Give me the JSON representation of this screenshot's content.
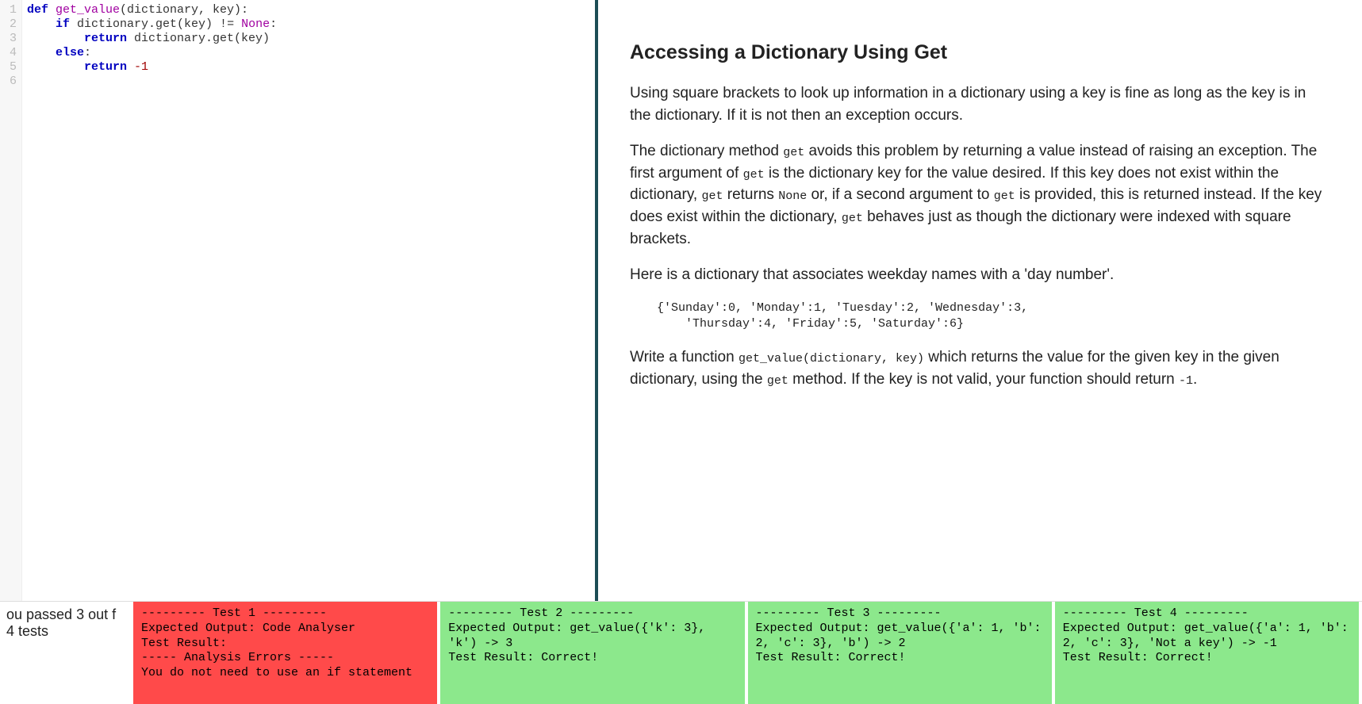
{
  "editor": {
    "line_numbers": [
      "1",
      "2",
      "3",
      "4",
      "5",
      "6"
    ],
    "tokens": [
      [
        {
          "t": "def ",
          "c": "tok-kw"
        },
        {
          "t": "get_value",
          "c": "tok-fn"
        },
        {
          "t": "(dictionary, key):",
          "c": ""
        }
      ],
      [
        {
          "t": "    ",
          "c": ""
        },
        {
          "t": "if",
          "c": "tok-kw"
        },
        {
          "t": " dictionary.get(key) != ",
          "c": ""
        },
        {
          "t": "None",
          "c": "tok-const"
        },
        {
          "t": ":",
          "c": ""
        }
      ],
      [
        {
          "t": "        ",
          "c": ""
        },
        {
          "t": "return",
          "c": "tok-kw"
        },
        {
          "t": " dictionary.get(key)",
          "c": ""
        }
      ],
      [
        {
          "t": "    ",
          "c": ""
        },
        {
          "t": "else",
          "c": "tok-kw"
        },
        {
          "t": ":",
          "c": ""
        }
      ],
      [
        {
          "t": "        ",
          "c": ""
        },
        {
          "t": "return",
          "c": "tok-kw"
        },
        {
          "t": " ",
          "c": ""
        },
        {
          "t": "-1",
          "c": "tok-num"
        }
      ],
      [
        {
          "t": "",
          "c": ""
        }
      ]
    ]
  },
  "doc": {
    "title": "Accessing a Dictionary Using Get",
    "p1": "Using square brackets to look up information in a dictionary using a key is fine as long as the key is in the dictionary. If it is not then an exception occurs.",
    "p2a": "The dictionary method ",
    "p2_code1": "get",
    "p2b": " avoids this problem by returning a value instead of raising an exception. The first argument of ",
    "p2_code2": "get",
    "p2c": " is the dictionary key for the value desired. If this key does not exist within the dictionary, ",
    "p2_code3": "get",
    "p2d": " returns ",
    "p2_code4": "None",
    "p2e": " or, if a second argument to ",
    "p2_code5": "get",
    "p2f": " is provided, this is returned instead. If the key does exist within the dictionary, ",
    "p2_code6": "get",
    "p2g": " behaves just as though the dictionary were indexed with square brackets.",
    "p3": "Here is a dictionary that associates weekday names with a 'day number'.",
    "code_block": "{'Sunday':0, 'Monday':1, 'Tuesday':2, 'Wednesday':3,\n    'Thursday':4, 'Friday':5, 'Saturday':6}",
    "p4a": "Write a function ",
    "p4_code1": "get_value(dictionary, key)",
    "p4b": " which returns the value for the given key in the given dictionary, using the ",
    "p4_code2": "get",
    "p4c": " method. If the key is not valid, your function should return ",
    "p4_code3": "-1",
    "p4d": "."
  },
  "results": {
    "summary": "ou passed 3 out f 4 tests",
    "tests": [
      {
        "status": "fail",
        "text": "--------- Test 1 ---------\nExpected Output: Code Analyser\nTest Result:\n----- Analysis Errors -----\nYou do not need to use an if statement"
      },
      {
        "status": "pass",
        "text": "--------- Test 2 ---------\nExpected Output: get_value({'k': 3}, 'k') -> 3\nTest Result: Correct!"
      },
      {
        "status": "pass",
        "text": "--------- Test 3 ---------\nExpected Output: get_value({'a': 1, 'b': 2, 'c': 3}, 'b') -> 2\nTest Result: Correct!"
      },
      {
        "status": "pass",
        "text": "--------- Test 4 ---------\nExpected Output: get_value({'a': 1, 'b': 2, 'c': 3}, 'Not a key') -> -1\nTest Result: Correct!"
      }
    ]
  }
}
